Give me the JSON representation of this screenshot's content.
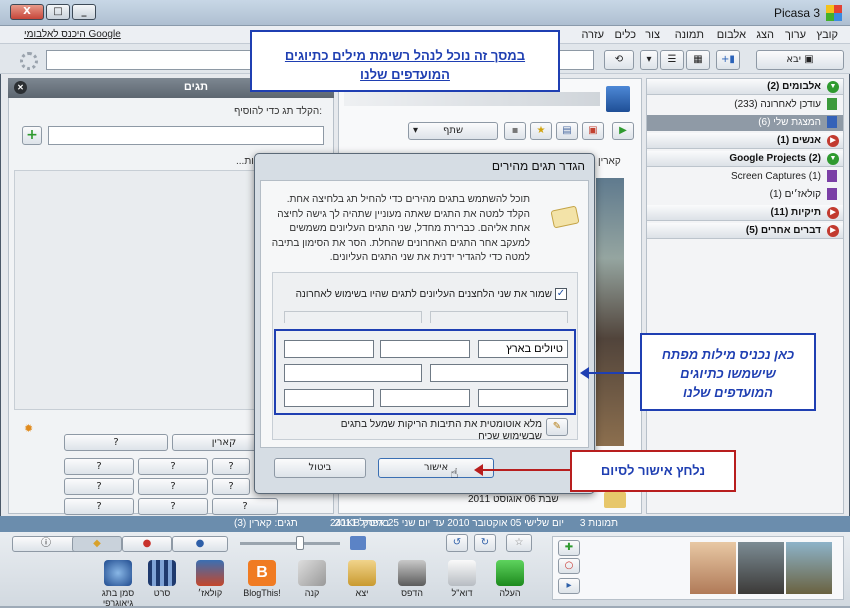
{
  "window": {
    "title": "Picasa 3",
    "btn_close": "X",
    "btn_max": "□",
    "btn_min": "_"
  },
  "menu": {
    "items": [
      "קובץ",
      "ערוך",
      "הצג",
      "אלבום",
      "תמונה",
      "צור",
      "כלים",
      "עזרה"
    ],
    "signin": "היכנס לאלבומי Google"
  },
  "toolbar": {
    "import": "יבא"
  },
  "tags_panel": {
    "title": "תגים",
    "add_label": "הקלד תג כדי להוסיף:",
    "list_label": "...ות:",
    "quick_tags": [
      "?",
      "קארין",
      "?",
      "?",
      "?",
      "?",
      "?",
      "?",
      "?",
      "?",
      "?",
      "?"
    ]
  },
  "center": {
    "share": "שתף",
    "folder_caption": "קארין",
    "date_label": "שבת 06 אוגוסט 2011"
  },
  "albums": {
    "sections": [
      {
        "title": "אלבומים (2)",
        "items": [
          "עודכן לאחרונה (233)",
          "המצגת שלי (6)"
        ]
      },
      {
        "title": "אנשים (1)",
        "items": []
      },
      {
        "title": "Google Projects (2)",
        "items": [
          "Screen Captures (1)",
          "קולאז׳ים (1)"
        ]
      },
      {
        "title": "תיקיות (11)",
        "items": []
      },
      {
        "title": "דברים אחרים (5)",
        "items": []
      }
    ]
  },
  "status": {
    "count": "3 תמונות",
    "range": "יום שלישי 05 אוקטובר 2010 עד יום שני 25 אפריל 2011",
    "size": "241KB בדיסק",
    "tags": "תגים: קארין (3)"
  },
  "bottom": {
    "actions": [
      "העלה",
      "דוא\"ל",
      "הדפס",
      "יצא",
      "קנה",
      "BlogThis!",
      "קולאז׳",
      "סרט",
      "סמן בתג גיאוגרפי"
    ]
  },
  "dialog": {
    "title": "הגדר תגים מהירים",
    "description": "תוכל להשתמש בתגים מהירים כדי להחיל תג בלחיצה אחת. הקלד למטה את התגים שאתה מעוניין שתהיה לך גישה לחיצה אחת אליהם. כברירת מחדל, שני התגים העליונים משמשים למעקב אחר התגים האחרונים שהחלת. הסר את הסימון בתיבה למטה כדי להגדיר ידנית את שני התגים העליונים.",
    "keep_recent": "שמור את שני הלחצנים העליונים לתגים שהיו בשימוש לאחרונה",
    "first_tag": "טיולים בארץ",
    "autofill": "מלא אוטומטית את התיבות הריקות שמעל בתגים שבשימוש שכיח",
    "ok": "אישור",
    "cancel": "ביטול"
  },
  "annotations": {
    "top": "במסך זה נוכל לנהל רשימת מילים כתיוגים המועדפים שלנו",
    "right": "כאן נכניס מילות מפתח שישמשו כתיוגים המועדפים שלנו",
    "bottom": "נלחץ אישור לסיום"
  }
}
